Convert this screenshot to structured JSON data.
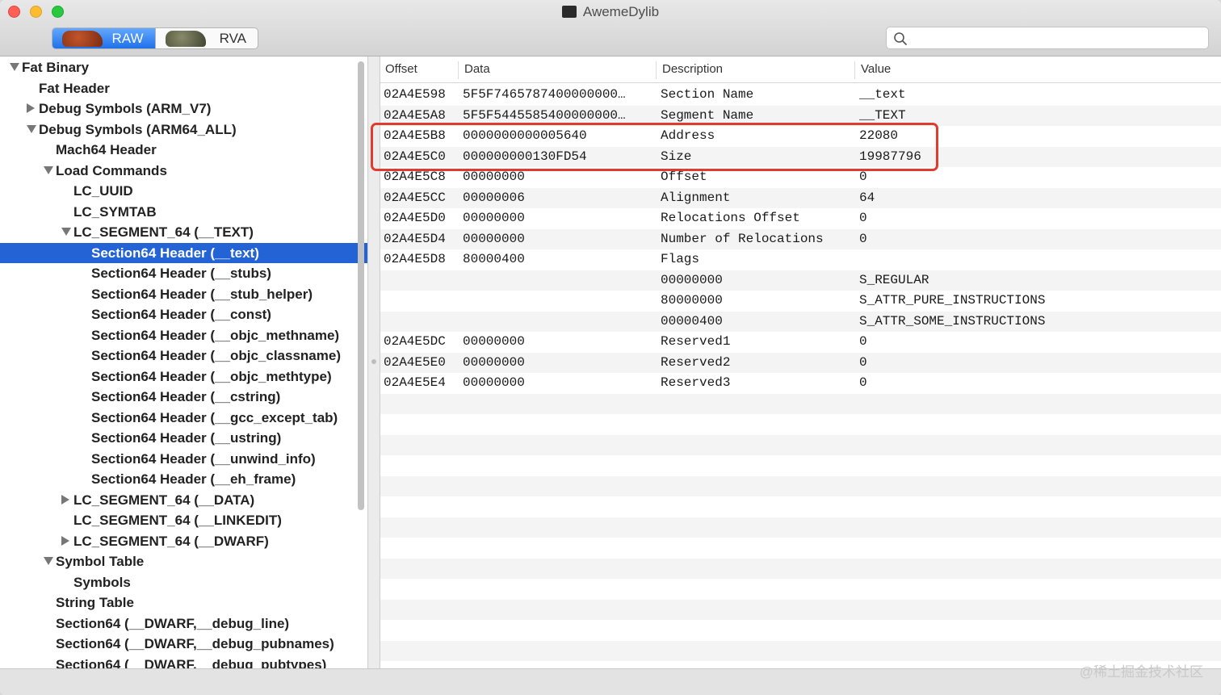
{
  "window": {
    "title": "AwemeDylib"
  },
  "toolbar": {
    "segments": [
      {
        "label": "RAW",
        "selected": true
      },
      {
        "label": "RVA",
        "selected": false
      }
    ],
    "search": {
      "value": "",
      "placeholder": ""
    }
  },
  "sidebar": {
    "items": [
      {
        "label": "Fat Binary",
        "level": 0,
        "disclosure": "down"
      },
      {
        "label": "Fat Header",
        "level": 1,
        "disclosure": "none"
      },
      {
        "label": "Debug Symbols (ARM_V7)",
        "level": 1,
        "disclosure": "right"
      },
      {
        "label": "Debug Symbols (ARM64_ALL)",
        "level": 1,
        "disclosure": "down"
      },
      {
        "label": "Mach64 Header",
        "level": 2,
        "disclosure": "none"
      },
      {
        "label": "Load Commands",
        "level": 2,
        "disclosure": "down"
      },
      {
        "label": "LC_UUID",
        "level": 3,
        "disclosure": "none"
      },
      {
        "label": "LC_SYMTAB",
        "level": 3,
        "disclosure": "none"
      },
      {
        "label": "LC_SEGMENT_64 (__TEXT)",
        "level": 3,
        "disclosure": "down"
      },
      {
        "label": "Section64 Header (__text)",
        "level": 4,
        "disclosure": "none",
        "selected": true
      },
      {
        "label": "Section64 Header (__stubs)",
        "level": 4,
        "disclosure": "none"
      },
      {
        "label": "Section64 Header (__stub_helper)",
        "level": 4,
        "disclosure": "none"
      },
      {
        "label": "Section64 Header (__const)",
        "level": 4,
        "disclosure": "none"
      },
      {
        "label": "Section64 Header (__objc_methname)",
        "level": 4,
        "disclosure": "none"
      },
      {
        "label": "Section64 Header (__objc_classname)",
        "level": 4,
        "disclosure": "none"
      },
      {
        "label": "Section64 Header (__objc_methtype)",
        "level": 4,
        "disclosure": "none"
      },
      {
        "label": "Section64 Header (__cstring)",
        "level": 4,
        "disclosure": "none"
      },
      {
        "label": "Section64 Header (__gcc_except_tab)",
        "level": 4,
        "disclosure": "none"
      },
      {
        "label": "Section64 Header (__ustring)",
        "level": 4,
        "disclosure": "none"
      },
      {
        "label": "Section64 Header (__unwind_info)",
        "level": 4,
        "disclosure": "none"
      },
      {
        "label": "Section64 Header (__eh_frame)",
        "level": 4,
        "disclosure": "none"
      },
      {
        "label": "LC_SEGMENT_64 (__DATA)",
        "level": 3,
        "disclosure": "right"
      },
      {
        "label": "LC_SEGMENT_64 (__LINKEDIT)",
        "level": 3,
        "disclosure": "none"
      },
      {
        "label": "LC_SEGMENT_64 (__DWARF)",
        "level": 3,
        "disclosure": "right"
      },
      {
        "label": "Symbol Table",
        "level": 2,
        "disclosure": "down"
      },
      {
        "label": "Symbols",
        "level": 3,
        "disclosure": "none"
      },
      {
        "label": "String Table",
        "level": 2,
        "disclosure": "none"
      },
      {
        "label": "Section64 (__DWARF,__debug_line)",
        "level": 2,
        "disclosure": "none"
      },
      {
        "label": "Section64 (__DWARF,__debug_pubnames)",
        "level": 2,
        "disclosure": "none"
      },
      {
        "label": "Section64 (__DWARF,__debug_pubtypes)",
        "level": 2,
        "disclosure": "none"
      }
    ]
  },
  "table": {
    "columns": [
      "Offset",
      "Data",
      "Description",
      "Value"
    ],
    "rows": [
      {
        "offset": "02A4E598",
        "data": "5F5F7465787400000000…",
        "description": "Section Name",
        "value": "__text"
      },
      {
        "offset": "02A4E5A8",
        "data": "5F5F5445585400000000…",
        "description": "Segment Name",
        "value": "__TEXT"
      },
      {
        "offset": "02A4E5B8",
        "data": "0000000000005640",
        "description": "Address",
        "value": "22080"
      },
      {
        "offset": "02A4E5C0",
        "data": "000000000130FD54",
        "description": "Size",
        "value": "19987796"
      },
      {
        "offset": "02A4E5C8",
        "data": "00000000",
        "description": "Offset",
        "value": "0"
      },
      {
        "offset": "02A4E5CC",
        "data": "00000006",
        "description": "Alignment",
        "value": "64"
      },
      {
        "offset": "02A4E5D0",
        "data": "00000000",
        "description": "Relocations Offset",
        "value": "0"
      },
      {
        "offset": "02A4E5D4",
        "data": "00000000",
        "description": "Number of Relocations",
        "value": "0"
      },
      {
        "offset": "02A4E5D8",
        "data": "80000400",
        "description": "Flags",
        "value": ""
      },
      {
        "offset": "",
        "data": "",
        "description": "00000000",
        "value": "S_REGULAR"
      },
      {
        "offset": "",
        "data": "",
        "description": "80000000",
        "value": "S_ATTR_PURE_INSTRUCTIONS"
      },
      {
        "offset": "",
        "data": "",
        "description": "00000400",
        "value": "S_ATTR_SOME_INSTRUCTIONS"
      },
      {
        "offset": "02A4E5DC",
        "data": "00000000",
        "description": "Reserved1",
        "value": "0"
      },
      {
        "offset": "02A4E5E0",
        "data": "00000000",
        "description": "Reserved2",
        "value": "0"
      },
      {
        "offset": "02A4E5E4",
        "data": "00000000",
        "description": "Reserved3",
        "value": "0"
      }
    ]
  },
  "watermark": "@稀土掘金技术社区",
  "colors": {
    "selection": "#2463d6",
    "highlight_box": "#e03b2e"
  }
}
